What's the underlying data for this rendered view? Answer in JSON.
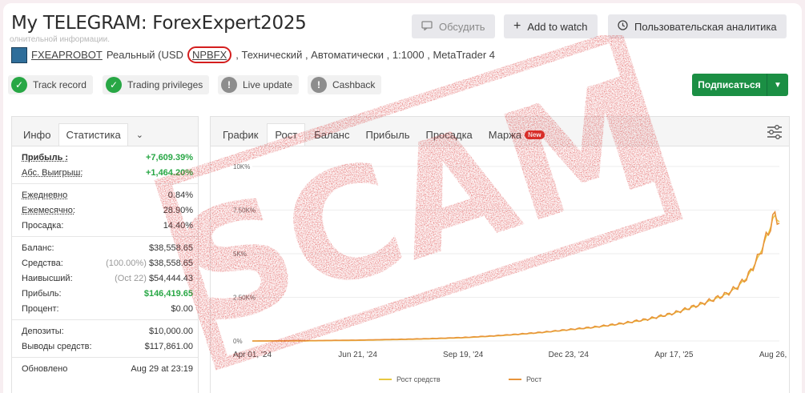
{
  "header": {
    "title": "My TELEGRAM: ForexExpert2025",
    "faded_text": "олнительной информации.",
    "discuss_label": "Обсудить",
    "watch_label": "Add to watch",
    "analytics_label": "Пользовательская аналитика"
  },
  "account_info": {
    "system_name": "FXEAPROBOT",
    "type": "Реальный (USD",
    "broker": "NPBFX",
    "details": ", Технический , Автоматически , 1:1000 , MetaTrader 4"
  },
  "badges": [
    {
      "label": "Track record",
      "status": "verified"
    },
    {
      "label": "Trading privileges",
      "status": "verified"
    },
    {
      "label": "Live update",
      "status": "unverified"
    },
    {
      "label": "Cashback",
      "status": "unverified"
    }
  ],
  "subscribe": {
    "label": "Подписаться"
  },
  "left_panel": {
    "tabs": [
      "Инфо",
      "Статистика"
    ],
    "stats": [
      {
        "label": "Прибыль :",
        "value": "+7,609.39%"
      },
      {
        "label": "Абс. Выигрыш:",
        "value": "+1,464.20%"
      },
      {
        "label": "Ежедневно",
        "value": "0.84%"
      },
      {
        "label": "Ежемесячно:",
        "value": "28.90%"
      },
      {
        "label": "Просадка:",
        "value": "14.40%"
      },
      {
        "label": "Баланс:",
        "value": "$38,558.65"
      },
      {
        "label": "Средства:",
        "prefix": "(100.00%)",
        "value": "$38,558.65"
      },
      {
        "label": "Наивысший:",
        "prefix": "(Oct 22)",
        "value": "$54,444.43"
      },
      {
        "label": "Прибыль:",
        "value": "$146,419.65"
      },
      {
        "label": "Процент:",
        "value": "$0.00"
      },
      {
        "label": "Депозиты:",
        "value": "$10,000.00"
      },
      {
        "label": "Выводы средств:",
        "value": "$117,861.00"
      },
      {
        "label": "Обновлено",
        "value": "Aug 29 at 23:19"
      }
    ]
  },
  "right_panel": {
    "tabs": [
      "График",
      "Рост",
      "Баланс",
      "Прибыль",
      "Просадка",
      "Маржа"
    ],
    "new_badge": "New"
  },
  "watermark": {
    "text": "SCAM"
  },
  "colors": {
    "growth_line": "#e8943a",
    "equity_line": "#e8c840",
    "accent_green": "#28a745",
    "stamp_red": "#d41e1e"
  },
  "chart_data": {
    "type": "line",
    "x_ticks": [
      "Apr 01, '24",
      "Jun 21, '24",
      "Sep 19, '24",
      "Dec 23, '24",
      "Apr 17, '25",
      "Aug 26, '25"
    ],
    "y_ticks": [
      "0%",
      "2.50K%",
      "5K%",
      "7.50K%",
      "10K%"
    ],
    "ylim": [
      0,
      10000
    ],
    "legend": [
      "Рост средств",
      "Рост"
    ],
    "series": [
      {
        "name": "Рост",
        "points": [
          [
            0,
            0
          ],
          [
            0.05,
            10
          ],
          [
            0.1,
            20
          ],
          [
            0.15,
            35
          ],
          [
            0.2,
            50
          ],
          [
            0.25,
            80
          ],
          [
            0.3,
            110
          ],
          [
            0.35,
            150
          ],
          [
            0.4,
            200
          ],
          [
            0.45,
            280
          ],
          [
            0.5,
            380
          ],
          [
            0.55,
            500
          ],
          [
            0.6,
            650
          ],
          [
            0.65,
            800
          ],
          [
            0.7,
            1000
          ],
          [
            0.75,
            1250
          ],
          [
            0.8,
            1600
          ],
          [
            0.85,
            2100
          ],
          [
            0.88,
            2450
          ],
          [
            0.9,
            2700
          ],
          [
            0.92,
            3100
          ],
          [
            0.94,
            3700
          ],
          [
            0.96,
            4800
          ],
          [
            0.98,
            6300
          ],
          [
            0.99,
            7200
          ],
          [
            1.0,
            6900
          ]
        ]
      }
    ]
  }
}
